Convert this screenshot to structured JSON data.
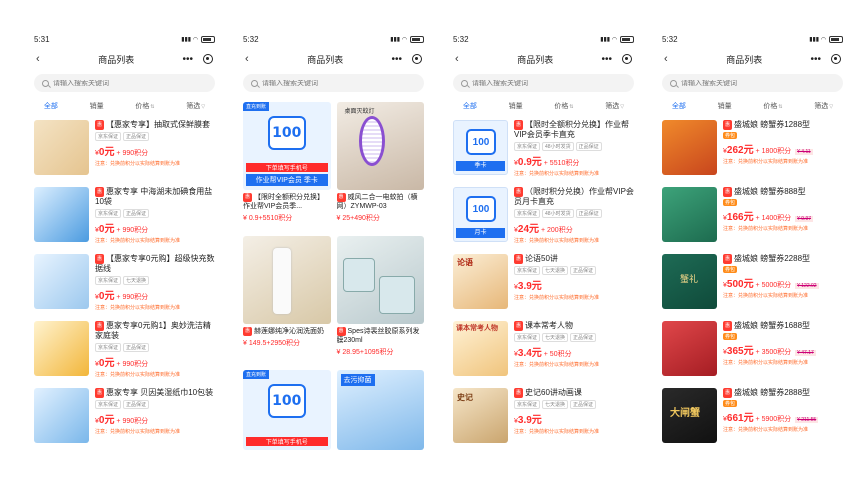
{
  "title": "商品列表",
  "search_placeholder": "请输入搜索关键词",
  "filters": [
    "全部",
    "销量",
    "价格",
    "筛选"
  ],
  "phones": [
    {
      "time": "5:31"
    },
    {
      "time": "5:32"
    },
    {
      "time": "5:32"
    },
    {
      "time": "5:32"
    }
  ],
  "p1": {
    "items": [
      {
        "name": "【惠家专享】抽取式保鲜膜套",
        "chips": [
          "京东保证",
          "正品保证"
        ],
        "price": "0元",
        "points": "+ 990积分",
        "note": "注意：兑换前积分以实际结算到账为准"
      },
      {
        "name": "惠家专享 中海湖未加碘食用盐10袋",
        "chips": [
          "京东保证",
          "正品保证"
        ],
        "price": "0元",
        "points": "+ 990积分",
        "note": "注意：兑换前积分以实际结算到账为准"
      },
      {
        "name": "【惠家专享0元购】超级快充数据线",
        "chips": [
          "京东保证",
          "七天退换"
        ],
        "price": "0元",
        "points": "+ 990积分",
        "note": "注意：兑换前积分以实际结算到账为准"
      },
      {
        "name": "惠家专享0元购1】奥妙洗洁精家庭装",
        "chips": [
          "京东保证",
          "正品保证"
        ],
        "price": "0元",
        "points": "+ 990积分",
        "note": "注意：兑换前积分以实际结算到账为准"
      },
      {
        "name": "惠家专享 贝因美湿纸巾10包装",
        "chips": [
          "京东保证",
          "正品保证"
        ],
        "price": "0元",
        "points": "+ 990积分",
        "note": "注意：兑换前积分以实际结算到账为准"
      }
    ]
  },
  "p2": {
    "cards": [
      {
        "ribbon": "直充到账",
        "tile": "100",
        "redbar": "下单填写手机号",
        "bar": "作业帮VIP会员 季卡",
        "name": "【限时全额积分兑换】作业帮VIP会员季...",
        "price": "¥ 0.9+5510积分"
      },
      {
        "name": "威风二合一电蚊拍（横网）ZYMWP-03",
        "price": "¥ 25+490积分",
        "overlay": "桌面灭蚊灯"
      },
      {
        "name": "赫莲娜纯净沁润洗面奶",
        "price": "¥ 149.5+2950积分"
      },
      {
        "name": "Spes诗裴丝胶原系列发膜230ml",
        "price": "¥ 28.95+1095积分"
      },
      {
        "ribbon": "直充到账",
        "tile": "100",
        "redbar": "下单填写手机号"
      },
      {
        "overlay": "去污抑菌"
      }
    ]
  },
  "p3": {
    "items": [
      {
        "name": "【限时全额积分兑换】作业帮VIP会员季卡直充",
        "chips": [
          "京东保证",
          "48小时发货",
          "正品保证"
        ],
        "price": "0.9元",
        "points": "+ 5510积分",
        "note": "注意：兑换前积分以实际结算到账为准"
      },
      {
        "name": "（限时积分兑换）作业帮VIP会员月卡直充",
        "chips": [
          "京东保证",
          "48小时发货",
          "正品保证"
        ],
        "price": "24元",
        "points": "+ 200积分",
        "note": "注意：兑换前积分以实际结算到账为准"
      },
      {
        "name": "论语50讲",
        "chips": [
          "京东保证",
          "七天退换",
          "正品保证"
        ],
        "price": "3.9元",
        "points": "",
        "note": "注意：兑换前积分以实际结算到账为准"
      },
      {
        "name": "课本常考人物",
        "chips": [
          "京东保证",
          "七天退换",
          "正品保证"
        ],
        "price": "3.4元",
        "points": "+ 50积分",
        "note": "注意：兑换前积分以实际结算到账为准"
      },
      {
        "name": "史记60讲动画课",
        "chips": [
          "京东保证",
          "七天退换",
          "正品保证"
        ],
        "price": "3.9元",
        "points": "",
        "note": "注意：兑换前积分以实际结算到账为准"
      }
    ],
    "thumb_texts": [
      "季卡",
      "月卡",
      "论语",
      "课本常考人物",
      "史记"
    ]
  },
  "p4": {
    "items": [
      {
        "name": "盛城娘 螃蟹券1288型",
        "price": "262元",
        "points": "+ 1800积分",
        "old": "¥ 4.11",
        "note": "注意：兑换前积分以实际结算到账为准"
      },
      {
        "name": "盛城娘 螃蟹券888型",
        "price": "166元",
        "points": "+ 1400积分",
        "old": "¥ 9.97",
        "note": "注意：兑换前积分以实际结算到账为准"
      },
      {
        "name": "盛城娘 螃蟹券2288型",
        "price": "500元",
        "points": "+ 5000积分",
        "old": "¥ 122.02",
        "note": "注意：兑换前积分以实际结算到账为准"
      },
      {
        "name": "盛城娘 螃蟹券1688型",
        "price": "365元",
        "points": "+ 3500积分",
        "old": "¥ 47.17",
        "note": "注意：兑换前积分以实际结算到账为准"
      },
      {
        "name": "盛城娘 螃蟹券2888型",
        "price": "661元",
        "points": "+ 5900积分",
        "old": "¥ 211.55",
        "note": "注意：兑换前积分以实际结算到账为准"
      }
    ],
    "tag": "券包",
    "thumb_texts": [
      "",
      "",
      "蟹礼",
      "",
      "大闸蟹"
    ]
  }
}
